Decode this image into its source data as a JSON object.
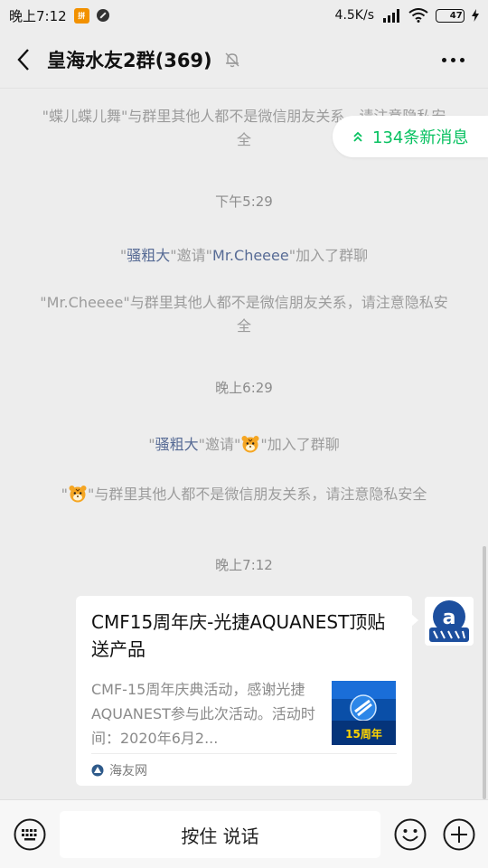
{
  "status_bar": {
    "time": "晚上7:12",
    "app_badge_text": "拼",
    "net_speed": "4.5K/s",
    "battery": "47"
  },
  "header": {
    "title": "皇海水友2群(369)"
  },
  "new_messages": {
    "label": "134条新消息"
  },
  "messages": {
    "m1": {
      "q1": "\"",
      "name": "蝶儿蝶儿舞",
      "text": "\"与群里其他人都不是微信朋友关系，请注意隐私安全"
    },
    "time1": "下午5:29",
    "m2": {
      "q1": "\"",
      "inviter": "骚粗大",
      "mid": "\"邀请\"",
      "invitee": "Mr.Cheeee",
      "end": "\"加入了群聊"
    },
    "m3": {
      "text": "\"Mr.Cheeee\"与群里其他人都不是微信朋友关系，请注意隐私安全"
    },
    "time2": "晚上6:29",
    "m4": {
      "q1": "\"",
      "inviter": "骚粗大",
      "mid": "\"邀请\"",
      "end": "\"加入了群聊"
    },
    "m5": {
      "q1": "\"",
      "text": "\"与群里其他人都不是微信朋友关系，请注意隐私安全"
    },
    "time3": "晚上7:12"
  },
  "card": {
    "title": "CMF15周年庆-光捷AQUANEST顶贴送产品",
    "description": "CMF-15周年庆典活动，感谢光捷AQUANEST参与此次活动。活动时间：2020年6月2...",
    "thumb_text": "15周年",
    "source": "海友网"
  },
  "input": {
    "hold_to_talk": "按住 说话"
  },
  "colors": {
    "accent_green": "#07c160",
    "link_blue": "#576b95",
    "system_gray": "#9c9c9c"
  },
  "icons": [
    "back-arrow-icon",
    "mute-bell-icon",
    "more-dots-icon",
    "double-chevron-up-icon",
    "keyboard-voice-icon",
    "emoji-icon",
    "plus-icon",
    "tiger-emoji-icon"
  ]
}
